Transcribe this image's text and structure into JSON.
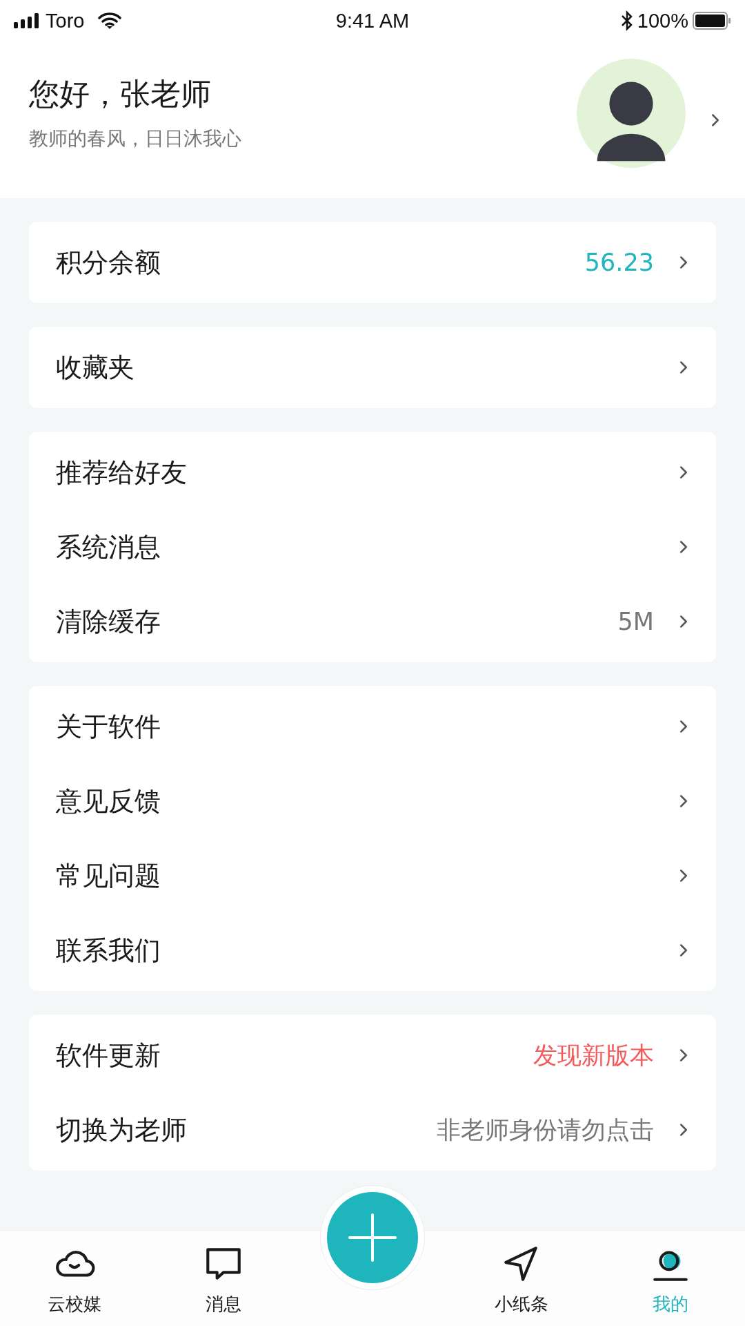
{
  "status_bar": {
    "carrier": "Toro",
    "time": "9:41 AM",
    "battery": "100%"
  },
  "profile": {
    "greeting": "您好，张老师",
    "motto": "教师的春风，日日沐我心"
  },
  "groups": [
    {
      "rows": [
        {
          "label": "积分余额",
          "value": "56.23",
          "color": "#1fb5bc"
        }
      ]
    },
    {
      "rows": [
        {
          "label": "收藏夹"
        }
      ]
    },
    {
      "rows": [
        {
          "label": "推荐给好友"
        },
        {
          "label": "系统消息"
        },
        {
          "label": "清除缓存",
          "value": "5M",
          "color": "#777777"
        }
      ]
    },
    {
      "rows": [
        {
          "label": "关于软件"
        },
        {
          "label": "意见反馈"
        },
        {
          "label": "常见问题"
        },
        {
          "label": "联系我们"
        }
      ]
    },
    {
      "rows": [
        {
          "label": "软件更新",
          "value": "发现新版本",
          "color": "#f55a5a"
        },
        {
          "label": "切换为老师",
          "value": "非老师身份请勿点击",
          "color": "#777777"
        }
      ]
    }
  ],
  "tab_bar": {
    "tabs": [
      {
        "label": "云校媒",
        "selected": false
      },
      {
        "label": "消息",
        "selected": false
      },
      {
        "label": "小纸条",
        "selected": false
      },
      {
        "label": "我的",
        "selected": true
      }
    ]
  }
}
